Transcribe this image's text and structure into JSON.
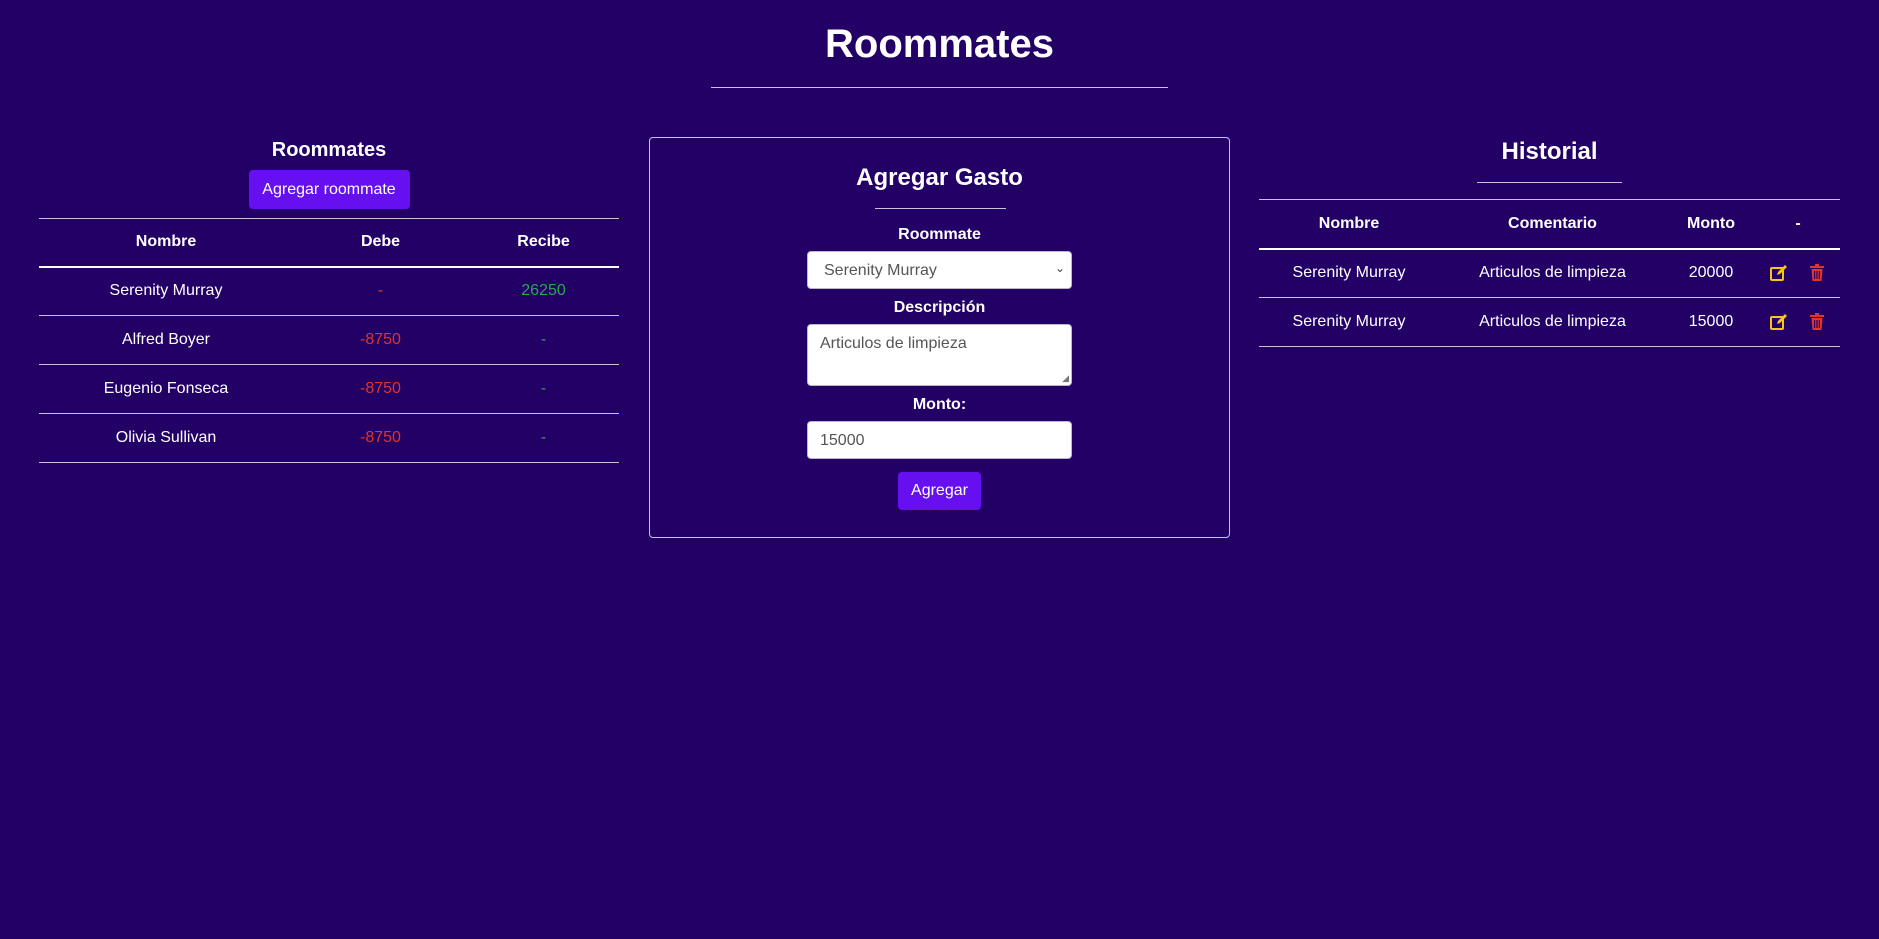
{
  "header": {
    "title": "Roommates"
  },
  "roommates_panel": {
    "heading": "Roommates",
    "add_button": "Agregar roommate",
    "columns": [
      "Nombre",
      "Debe",
      "Recibe"
    ],
    "rows": [
      {
        "nombre": "Serenity Murray",
        "debe": "-",
        "recibe": "26250"
      },
      {
        "nombre": "Alfred Boyer",
        "debe": "-8750",
        "recibe": "-"
      },
      {
        "nombre": "Eugenio Fonseca",
        "debe": "-8750",
        "recibe": "-"
      },
      {
        "nombre": "Olivia Sullivan",
        "debe": "-8750",
        "recibe": "-"
      }
    ]
  },
  "form": {
    "title": "Agregar Gasto",
    "roommate_label": "Roommate",
    "roommate_selected": "Serenity Murray",
    "descripcion_label": "Descripción",
    "descripcion_value": "Articulos de limpieza",
    "monto_label": "Monto:",
    "monto_value": "15000",
    "submit": "Agregar"
  },
  "historial": {
    "title": "Historial",
    "columns": [
      "Nombre",
      "Comentario",
      "Monto",
      "-"
    ],
    "rows": [
      {
        "nombre": "Serenity Murray",
        "comentario": "Articulos de limpieza",
        "monto": "20000",
        "edit_icon": "edit-icon",
        "delete_icon": "trash-icon"
      },
      {
        "nombre": "Serenity Murray",
        "comentario": "Articulos de limpieza",
        "monto": "15000",
        "edit_icon": "edit-icon",
        "delete_icon": "trash-icon"
      }
    ]
  },
  "colors": {
    "background": "#230066",
    "primary_button": "#6610f2",
    "negative": "#e0342c",
    "positive": "#2aa84f",
    "edit_icon": "#f5c518",
    "delete_icon": "#e0342c"
  }
}
